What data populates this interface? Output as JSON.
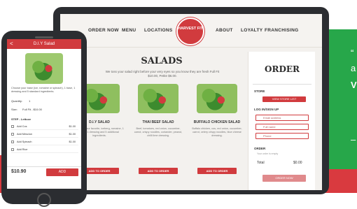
{
  "green_panel": {
    "quote_mark": "“",
    "line_a": "a",
    "line_w": "V",
    "dash": "–"
  },
  "laptop": {
    "nav": {
      "order_now": "ORDER NOW",
      "menu": "MENU",
      "locations": "LOCATIONS",
      "logo_text": "HARVEST FIT",
      "about": "ABOUT",
      "loyalty": "LOYALTY",
      "franchising": "FRANCHISING"
    },
    "page_title": "SALADS",
    "intro": "We toss your salad right before your very eyes so you know they are fresh Full Fit $10.00, Petite $6.00.",
    "cards": [
      {
        "title": "D.I.Y SALAD",
        "desc": "Choose your favorite, iceberg, romaine, 1 base, 1 dressing and 5 additional ingredients.",
        "button": "ADD TO ORDER"
      },
      {
        "title": "THAI BEEF SALAD",
        "desc": "Beef, tomatoes, red onion, cucumber, carrot, crispy noodles, coriander, peanut, chilli lime dressing.",
        "button": "ADD TO ORDER"
      },
      {
        "title": "BUFFALO CHICKEN SALAD",
        "desc": "Buffalo chicken, cos, red onion, cucumber, carrot, celery crispy noodles, blue cheese dressing.",
        "button": "ADD TO ORDER"
      }
    ],
    "order": {
      "title": "ORDER",
      "store_label": "STORE",
      "store_button": "VIEW STORE LIST",
      "login_label": "LOG IN/SIGN UP",
      "email_placeholder": "Email address",
      "name_placeholder": "Full name",
      "phone_placeholder": "Phone",
      "order_label": "ORDER",
      "order_empty": "Your order is empty",
      "total_label": "Total",
      "total_value": "$0.00",
      "cta": "ORDER NOW"
    }
  },
  "phone": {
    "back": "<",
    "title": "D.I.Y Salad",
    "desc": "Choose your base (ice, romaine or spinach), 1 base, 1 dressing and 5 standard ingredients.",
    "quantity_label": "Quantity:",
    "quantity_value": "1",
    "size_label": "Size:",
    "size_value": "Full Fit - $10.00",
    "section_label": "STEP - Lettuce",
    "rows": [
      {
        "label": "Add Cos",
        "price": "$1.00"
      },
      {
        "label": "Add Mesclun",
        "price": "$1.00"
      },
      {
        "label": "Add Spinach",
        "price": "$1.00"
      },
      {
        "label": "Add Rice",
        "price": ""
      }
    ],
    "price": "$10.90",
    "add": "ADD"
  },
  "colors": {
    "brand_red": "#d13b3e",
    "band_red": "#d93a3f",
    "green": "#27a74a",
    "device": "#2b2d31"
  }
}
